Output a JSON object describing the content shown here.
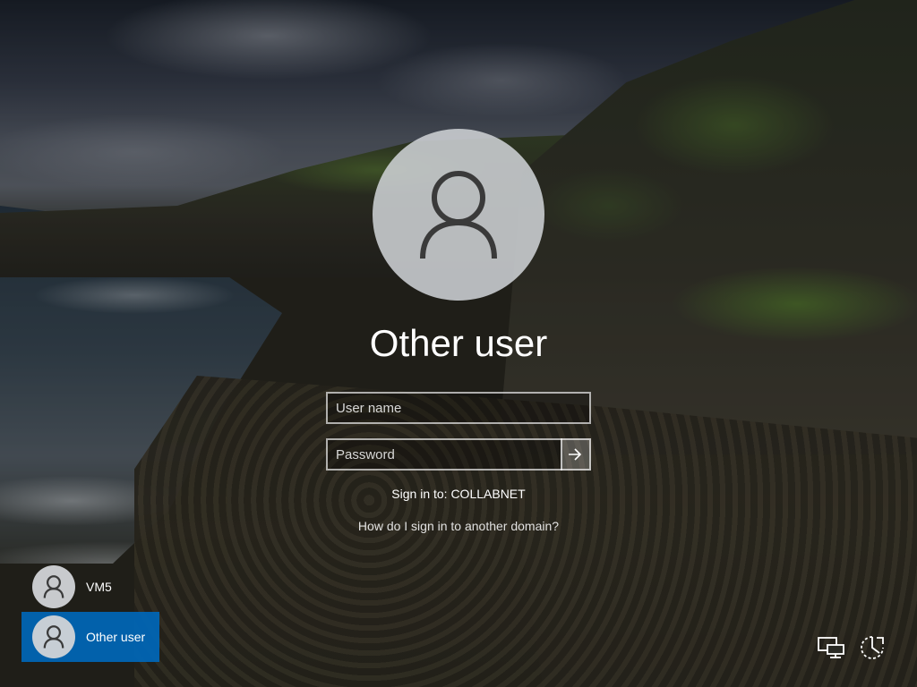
{
  "signin": {
    "user_title": "Other user",
    "username_placeholder": "User name",
    "username_value": "",
    "password_placeholder": "Password",
    "password_value": "",
    "submit_icon": "arrow-right-icon",
    "sign_in_to": "Sign in to: COLLABNET",
    "help_link": "How do I sign in to another domain?"
  },
  "users": [
    {
      "label": "VM5",
      "icon": "user-icon",
      "selected": false
    },
    {
      "label": "Other user",
      "icon": "user-icon",
      "selected": true
    }
  ],
  "system_icons": [
    {
      "name": "network-icon"
    },
    {
      "name": "ease-of-access-icon"
    }
  ],
  "colors": {
    "selected_tile": "#0067b8",
    "text": "#ffffff",
    "avatar_bg": "#cdd0d4",
    "avatar_glyph": "#3a3a3a"
  }
}
